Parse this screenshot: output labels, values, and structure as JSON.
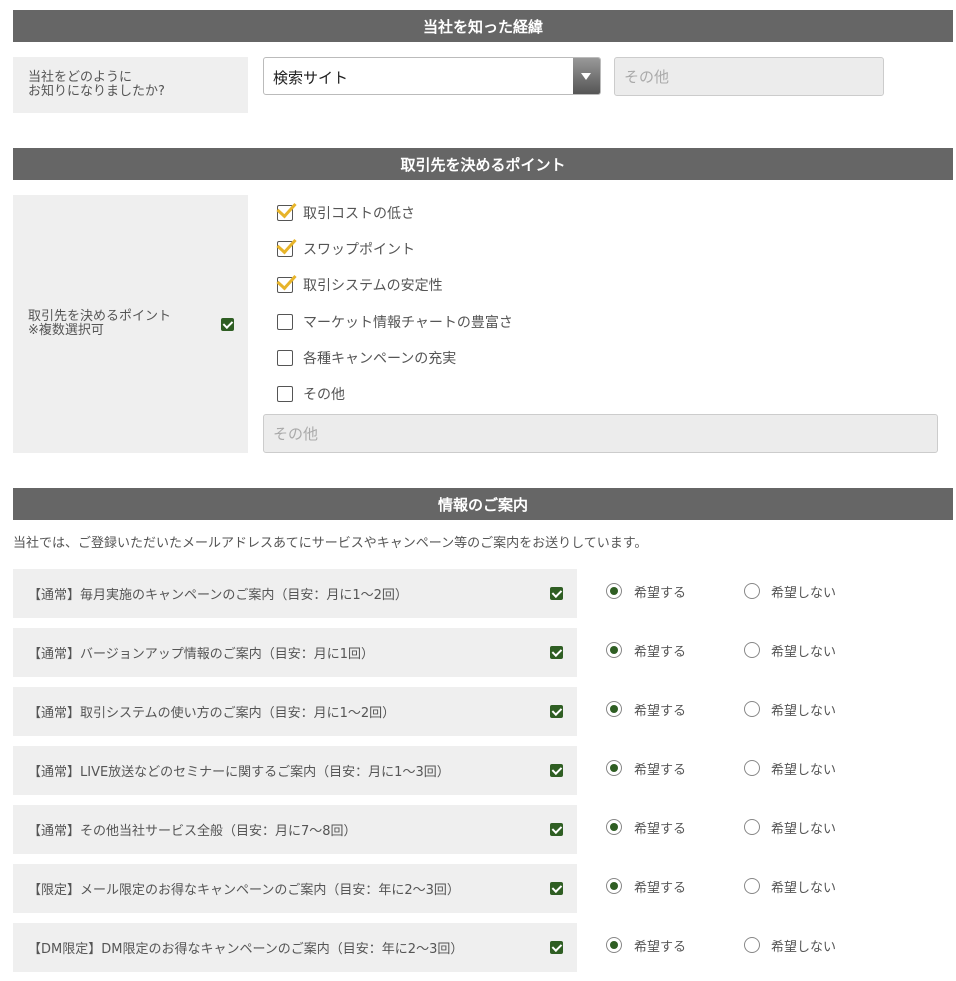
{
  "section1": {
    "title": "当社を知った経緯",
    "label_line1": "当社をどのように",
    "label_line2": "お知りになりましたか?",
    "select_value": "検索サイト",
    "other_placeholder": "その他"
  },
  "section2": {
    "title": "取引先を決めるポイント",
    "label_line1": "取引先を決めるポイント",
    "label_line2": "※複数選択可",
    "options": [
      {
        "label": "取引コストの低さ",
        "checked": true
      },
      {
        "label": "スワップポイント",
        "checked": true
      },
      {
        "label": "取引システムの安定性",
        "checked": true
      },
      {
        "label": "マーケット情報チャートの豊富さ",
        "checked": false
      },
      {
        "label": "各種キャンペーンの充実",
        "checked": false
      },
      {
        "label": "その他",
        "checked": false
      }
    ],
    "other_placeholder": "その他"
  },
  "section3": {
    "title": "情報のご案内",
    "intro": "当社では、ご登録いただいたメールアドレスあてにサービスやキャンペーン等のご案内をお送りしています。",
    "yes_label": "希望する",
    "no_label": "希望しない",
    "items": [
      {
        "label": "【通常】毎月実施のキャンペーンのご案内（目安：月に1～2回）",
        "choice": "yes"
      },
      {
        "label": "【通常】バージョンアップ情報のご案内（目安：月に1回）",
        "choice": "yes"
      },
      {
        "label": "【通常】取引システムの使い方のご案内（目安：月に1～2回）",
        "choice": "yes"
      },
      {
        "label": "【通常】LIVE放送などのセミナーに関するご案内（目安：月に1～3回）",
        "choice": "yes"
      },
      {
        "label": "【通常】その他当社サービス全般（目安：月に7～8回）",
        "choice": "yes"
      },
      {
        "label": "【限定】メール限定のお得なキャンペーンのご案内（目安：年に2～3回）",
        "choice": "yes"
      },
      {
        "label": "【DM限定】DM限定のお得なキャンペーンのご案内（目安：年に2～3回）",
        "choice": "yes"
      }
    ]
  },
  "colors": {
    "header_bg": "#666666",
    "label_bg": "#efefef",
    "accent_green": "#2f5e23",
    "check_yellow": "#e7b42a"
  }
}
